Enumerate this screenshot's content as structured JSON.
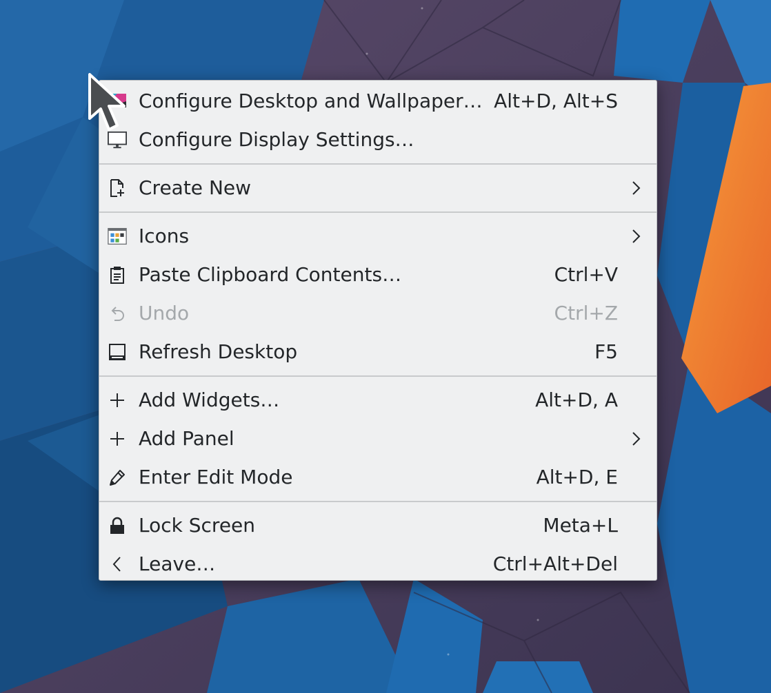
{
  "colors": {
    "menu_background": "#eff0f1",
    "text": "#232629",
    "disabled_text": "#a4a8ab",
    "accent_orange": "#f0782a",
    "wallpaper_blue": "#1f6fb3",
    "wallpaper_purple": "#4a3d5c"
  },
  "menu": {
    "items": [
      {
        "icon": "desktop-wallpaper-icon",
        "label": "Configure Desktop and Wallpaper…",
        "shortcut": "Alt+D, Alt+S"
      },
      {
        "icon": "monitor-icon",
        "label": "Configure Display Settings…",
        "shortcut": ""
      },
      {
        "icon": "new-document-icon",
        "label": "Create New",
        "submenu": true
      },
      {
        "icon": "icons-grid-icon",
        "label": "Icons",
        "submenu": true
      },
      {
        "icon": "clipboard-icon",
        "label": "Paste Clipboard Contents…",
        "shortcut": "Ctrl+V"
      },
      {
        "icon": "undo-icon",
        "label": "Undo",
        "shortcut": "Ctrl+Z",
        "disabled": true
      },
      {
        "icon": "refresh-desktop-icon",
        "label": "Refresh Desktop",
        "shortcut": "F5"
      },
      {
        "icon": "plus-icon",
        "label": "Add Widgets…",
        "shortcut": "Alt+D, A"
      },
      {
        "icon": "plus-icon",
        "label": "Add Panel",
        "submenu": true
      },
      {
        "icon": "pencil-icon",
        "label": "Enter Edit Mode",
        "shortcut": "Alt+D, E"
      },
      {
        "icon": "lock-icon",
        "label": "Lock Screen",
        "shortcut": "Meta+L"
      },
      {
        "icon": "chevron-left-icon",
        "label": "Leave…",
        "shortcut": "Ctrl+Alt+Del"
      }
    ]
  }
}
